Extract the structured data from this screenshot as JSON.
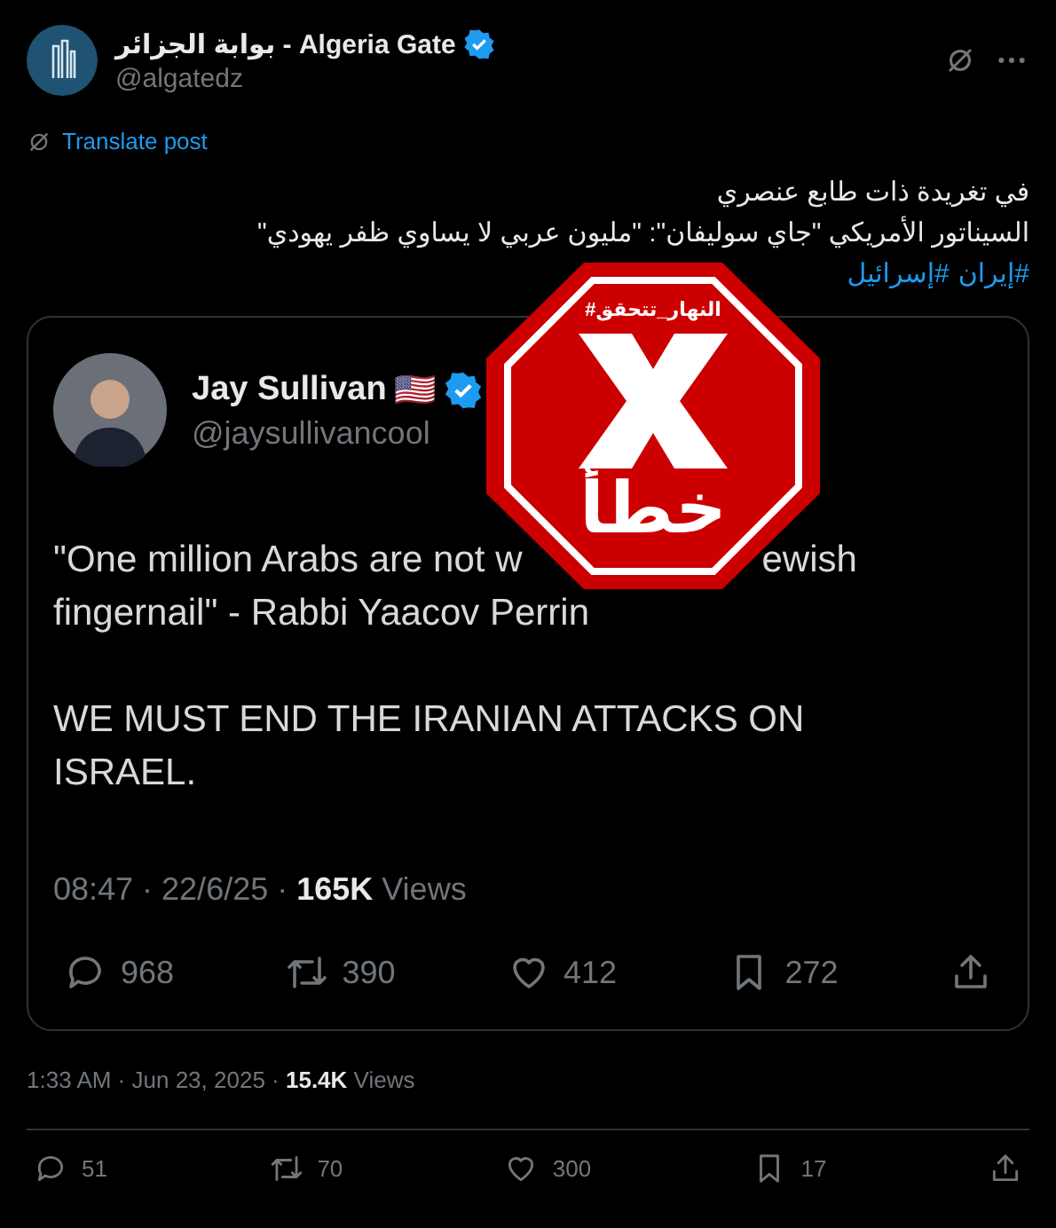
{
  "author": {
    "name": "بوابة الجزائر - Algeria Gate",
    "handle": "@algatedz",
    "verified": true
  },
  "translate": "Translate post",
  "text_lines": [
    "في تغريدة ذات طابع عنصري",
    "السيناتور الأمريكي \"جاي سوليفان\": \"مليون عربي لا يساوي ظفر يهودي\""
  ],
  "hashtags": [
    "#إيران",
    "#إسرائيل"
  ],
  "quoted": {
    "name": "Jay Sullivan",
    "flag": "🇺🇸",
    "handle": "@jaysullivancool",
    "verified": true,
    "quote_left": "\"One million Arabs are not w",
    "quote_right": "ewish",
    "quote_line2": "fingernail\" - Rabbi Yaacov Perrin",
    "body": "WE MUST END THE IRANIAN ATTACKS ON ISRAEL.",
    "time": "08:47 · 22/6/25 · ",
    "views_count": "165K",
    "views_label": " Views",
    "actions": [
      {
        "kind": "reply",
        "count": "968"
      },
      {
        "kind": "repost",
        "count": "390"
      },
      {
        "kind": "like",
        "count": "412"
      },
      {
        "kind": "bookmark",
        "count": "272"
      },
      {
        "kind": "share"
      }
    ]
  },
  "stamp": {
    "tag": "#النهار_تتحقق",
    "verdict": "خطأ"
  },
  "meta": {
    "time": "1:33 AM · Jun 23, 2025 · ",
    "views_count": "15.4K",
    "views_label": " Views"
  },
  "actions": [
    {
      "kind": "reply",
      "count": "51"
    },
    {
      "kind": "repost",
      "count": "70"
    },
    {
      "kind": "like",
      "count": "300"
    },
    {
      "kind": "bookmark",
      "count": "17"
    },
    {
      "kind": "share"
    }
  ]
}
